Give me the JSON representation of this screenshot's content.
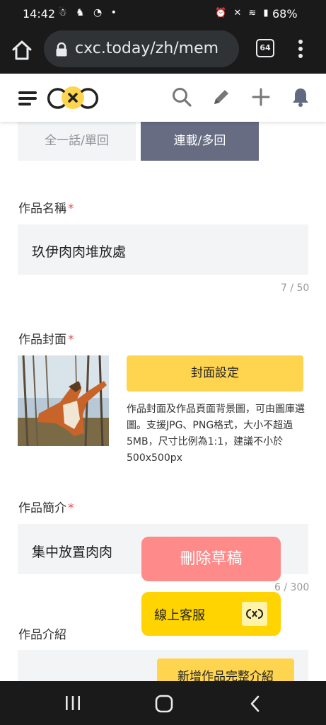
{
  "status_bar": {
    "time": "14:42",
    "left_icons": "☃ ♞ ◔ •",
    "right_icons": "⏰ ✕ ≋ ▮",
    "battery": "68%"
  },
  "browser": {
    "url": "cxc.today/zh/mem",
    "tab_count": "64"
  },
  "tabs": {
    "single": "全一話/單回",
    "serial": "連載/多回"
  },
  "title_field": {
    "label": "作品名稱",
    "required_mark": "*",
    "value": "玖伊肉肉堆放處",
    "counter": "7 / 50"
  },
  "cover": {
    "label": "作品封面",
    "required_mark": "*",
    "button": "封面設定",
    "description": "作品封面及作品頁面背景圖，可由圖庫選圖。支援JPG、PNG格式，大小不超過5MB，尺寸比例為1:1，建議不小於500x500px"
  },
  "summary_field": {
    "label": "作品簡介",
    "required_mark": "*",
    "value": "集中放置肉肉",
    "counter": "6 / 300"
  },
  "floating": {
    "delete_draft": "刪除草稿",
    "online_service": "線上客服"
  },
  "intro": {
    "label": "作品介紹",
    "add_button": "新增作品完整介紹"
  },
  "colors": {
    "accent_yellow": "#ffd54f",
    "tab_active": "#676c82",
    "delete_red": "#ff8a8a",
    "required_red": "#e04a4a"
  }
}
